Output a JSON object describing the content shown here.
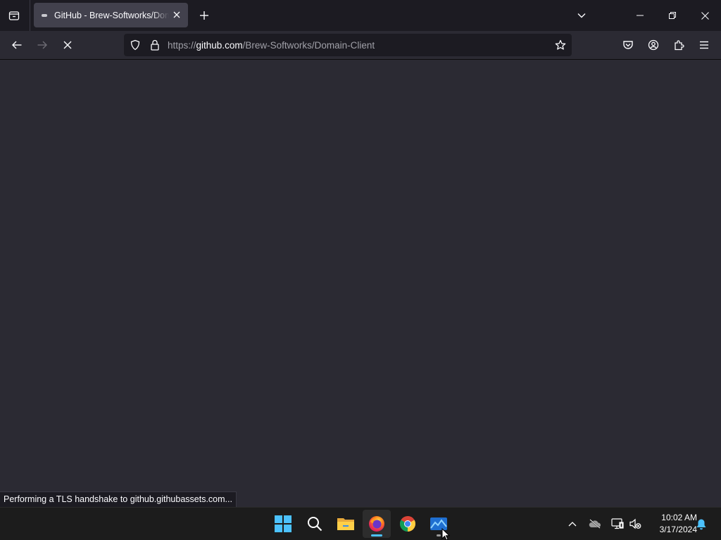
{
  "browser": {
    "tab": {
      "title": "GitHub - Brew-Softworks/Domain-Client"
    },
    "url": {
      "prefix": "https://",
      "host": "github.com",
      "path": "/Brew-Softworks/Domain-Client"
    },
    "status_text": "Performing a TLS handshake to github.githubassets.com...",
    "loading": true
  },
  "taskbar": {
    "apps": [
      {
        "name": "Start",
        "icon": "windows-start-icon"
      },
      {
        "name": "Search",
        "icon": "search-icon"
      },
      {
        "name": "File Explorer",
        "icon": "folder-icon"
      },
      {
        "name": "Firefox",
        "icon": "firefox-icon",
        "active": true
      },
      {
        "name": "Chrome",
        "icon": "chrome-icon"
      },
      {
        "name": "Photos",
        "icon": "photos-icon",
        "running": true
      }
    ],
    "tray": {
      "time": "10:02 AM",
      "date": "3/17/2024",
      "icons": [
        "chevron-up-icon",
        "onedrive-offline-icon",
        "network-icon",
        "volume-muted-icon",
        "notification-bell-icon"
      ]
    }
  },
  "colors": {
    "accent": "#4cc2ff",
    "page_bg": "#2b2a33",
    "chrome_bg": "#1c1b22"
  }
}
